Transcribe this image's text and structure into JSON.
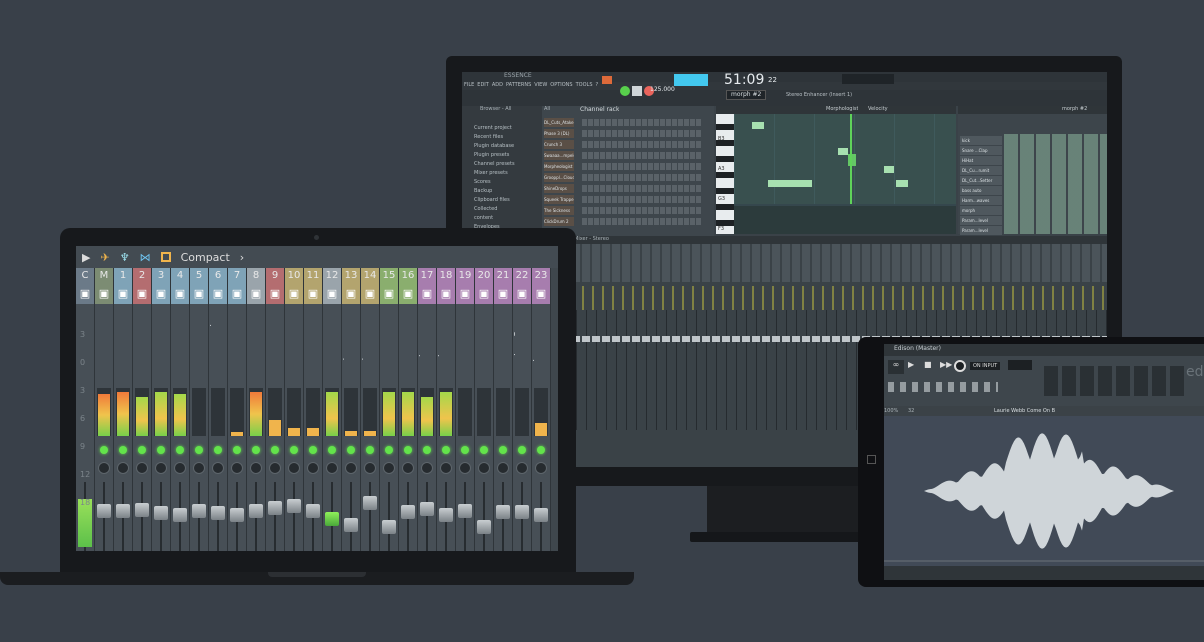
{
  "laptop": {
    "mixer": {
      "toolbar_view_mode": "Compact",
      "toolbar_icons": [
        "play-arrow-icon",
        "duck-icon",
        "tree-icon",
        "wing-icon",
        "box-icon"
      ],
      "strips": [
        {
          "num": "C",
          "label": "",
          "icon": "speaker-icon",
          "color": "#6b7a88"
        },
        {
          "num": "M",
          "label": "MAST..RACK",
          "icon": "master-icon",
          "color": "#7c8c73"
        },
        {
          "num": "1",
          "label": "MON...GNAL",
          "icon": "clipboard-icon",
          "color": "#7fa3b7"
        },
        {
          "num": "2",
          "label": "STERE..IELD",
          "icon": "crop-icon",
          "color": "#b46d70"
        },
        {
          "num": "3",
          "label": "SUB - 1",
          "icon": "split-icon",
          "color": "#7fa3b7"
        },
        {
          "num": "4",
          "label": "SUB - 2",
          "icon": "split-icon",
          "color": "#7fa3b7"
        },
        {
          "num": "5",
          "label": "SUB -..itars",
          "icon": "split-icon",
          "color": "#7fa3b7"
        },
        {
          "num": "6",
          "label": "Sub -..Clap",
          "icon": "split-icon",
          "color": "#7fa3b7"
        },
        {
          "num": "7",
          "label": "Chords Sub",
          "icon": "split-icon",
          "color": "#7fa3b7"
        },
        {
          "num": "8",
          "label": "Kick",
          "icon": "drum-icon",
          "color": "#9aa4ab"
        },
        {
          "num": "9",
          "label": "Bass",
          "icon": "guitar-icon",
          "color": "#b46d70"
        },
        {
          "num": "10",
          "label": "Snare",
          "icon": "snare-icon",
          "color": "#b3a46e"
        },
        {
          "num": "11",
          "label": "Snare 2",
          "icon": "snare-icon",
          "color": "#b3a46e"
        },
        {
          "num": "12",
          "label": "Hihat",
          "icon": "hihat-icon",
          "color": "#9aa4ab"
        },
        {
          "num": "13",
          "label": "clap 1",
          "icon": "exclaim-icon",
          "color": "#b3a46e"
        },
        {
          "num": "14",
          "label": "clap 2",
          "icon": "exclaim-icon",
          "color": "#b3a46e"
        },
        {
          "num": "15",
          "label": "Shaker",
          "icon": "shaker-icon",
          "color": "#8aae6e"
        },
        {
          "num": "16",
          "label": "Shaker 2",
          "icon": "shaker-icon",
          "color": "#8aae6e"
        },
        {
          "num": "17",
          "label": "Loop",
          "icon": "loop-icon",
          "color": "#a77dae"
        },
        {
          "num": "18",
          "label": "Loop 2",
          "icon": "loop-icon",
          "color": "#a77dae"
        },
        {
          "num": "19",
          "label": "Dela..ashed",
          "icon": "keys-icon",
          "color": "#a77dae"
        },
        {
          "num": "20",
          "label": "Chord 1",
          "icon": "keys-icon",
          "color": "#a77dae"
        },
        {
          "num": "21",
          "label": "Chord 2",
          "icon": "keys-icon",
          "color": "#a77dae"
        },
        {
          "num": "22",
          "label": "Morph..gist",
          "icon": "keys-icon",
          "color": "#a77dae"
        },
        {
          "num": "23",
          "label": "Repet..ulse",
          "icon": "keys-icon",
          "color": "#a77dae"
        }
      ],
      "meter_levels": [
        0.0,
        0.92,
        0.95,
        0.85,
        0.95,
        0.92,
        0.0,
        0.0,
        0.08,
        0.95,
        0.35,
        0.18,
        0.18,
        0.95,
        0.1,
        0.1,
        0.95,
        0.95,
        0.85,
        0.95,
        0.0,
        0.0,
        0.0,
        0.0,
        0.28
      ],
      "fader_levels": [
        0.0,
        0.62,
        0.62,
        0.64,
        0.58,
        0.56,
        0.62,
        0.59,
        0.55,
        0.62,
        0.68,
        0.71,
        0.62,
        0.48,
        0.38,
        0.76,
        0.35,
        0.6,
        0.65,
        0.56,
        0.62,
        0.35,
        0.6,
        0.6,
        0.55
      ],
      "left_scale": [
        "3",
        "0",
        "3",
        "6",
        "9",
        "12",
        "18"
      ]
    }
  },
  "monitor": {
    "title": "ESSENCE",
    "menu": [
      "FILE",
      "EDIT",
      "ADD",
      "PATTERNS",
      "VIEW",
      "OPTIONS",
      "TOOLS",
      "?"
    ],
    "time": "51:09",
    "time_sub": "22",
    "tempo": "125.000",
    "pattern": "morph #2",
    "hint": "Stereo Enhancer (Insert 1)",
    "browser": {
      "header": "Browser - All",
      "items": [
        "Current project",
        "Recent files",
        "Plugin database",
        "Plugin presets",
        "Channel presets",
        "Mixer presets",
        "Scores",
        "Backup",
        "Clipboard files",
        "Collected",
        "content",
        "Envelopes"
      ]
    },
    "channel_rack": {
      "header": "Channel rack",
      "filter": "All",
      "channels": [
        "DL_Cuts_Atake",
        "Phase 3 (DL)",
        "Crunch 3",
        "Swaaaa...mpeles",
        "Morpheologist",
        "Grooppl...Cloud",
        "ShineDrops",
        "Squeek Trapper",
        "The Sickness",
        "ClickDrum 2"
      ]
    },
    "piano_roll": {
      "header": "Morphologist",
      "target": "Velocity",
      "keys": [
        "B3",
        "A3",
        "G3",
        "F3"
      ]
    },
    "playlist": {
      "pattern": "morph #2",
      "tracks": [
        "kick",
        "Snare ...Clap",
        "HiHat",
        "DL_Cu...rumit",
        "DL_Cut...Setter",
        "bass auto",
        "Harm...waves",
        "morph",
        "Param...level",
        "Param...level"
      ]
    },
    "mixer_header": "Mixer - Stereo"
  },
  "tablet": {
    "title": "Edison (Master)",
    "on_input": "ON INPUT",
    "sample_name": "Laurie Webb Come On B",
    "zoom": "100%",
    "value": "32",
    "logo": "ed"
  }
}
